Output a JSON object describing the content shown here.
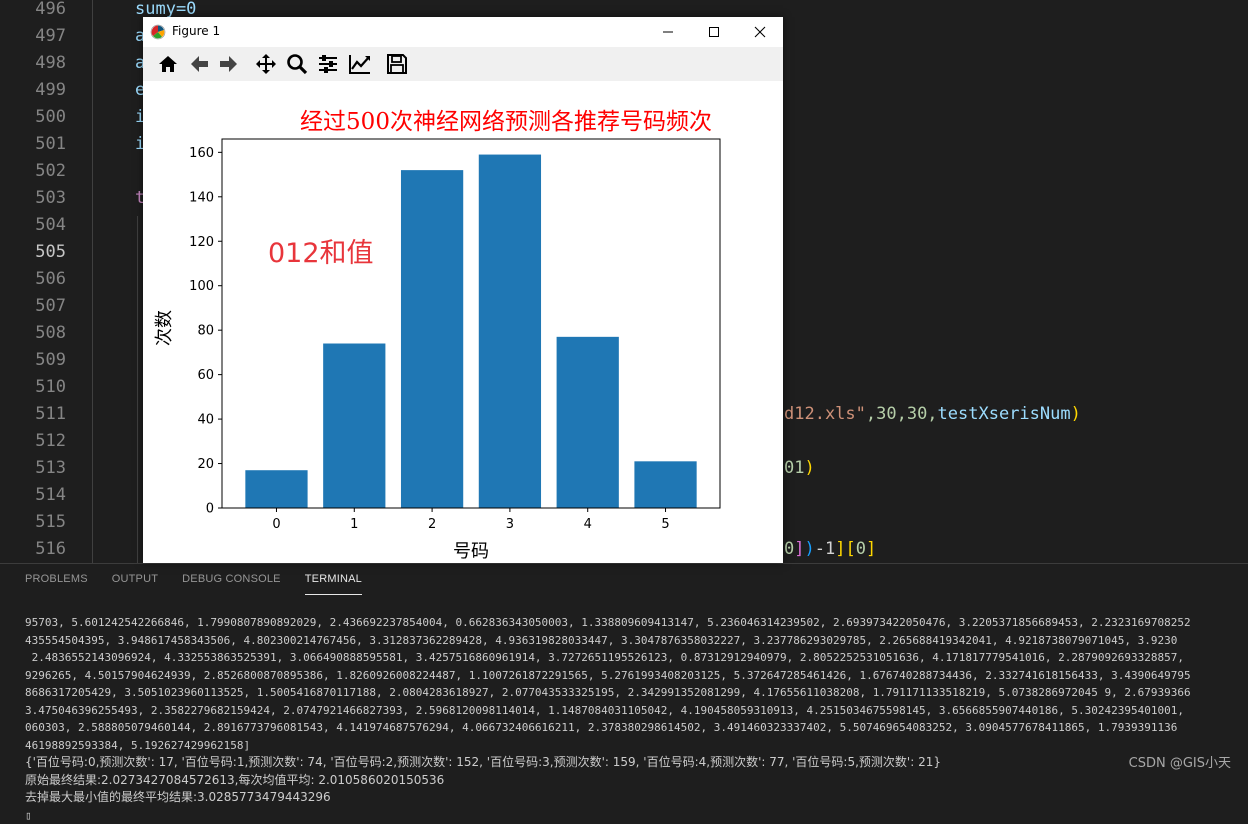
{
  "editor": {
    "line_numbers": [
      "496",
      "497",
      "498",
      "499",
      "500",
      "501",
      "502",
      "503",
      "504",
      "505",
      "506",
      "507",
      "508",
      "509",
      "510",
      "511",
      "512",
      "513",
      "514",
      "515",
      "516"
    ],
    "current_line_index": 9,
    "visible_fragments": {
      "l496": "sumy=0",
      "l497": "a",
      "l498": "a",
      "l499": "e",
      "l500": "i",
      "l501": "i",
      "l503": "t",
      "l511_str": "d12.xls\"",
      "l511_args": ",30,30,",
      "l511_var": "testXserisNum",
      "l511_paren": ")",
      "l513_num": "01",
      "l513_paren": ")",
      "l516_idx": "0",
      "l516_b1": "]",
      "l516_p": ")",
      "l516_m": "-1",
      "l516_b2": "][",
      "l516_zero": "0",
      "l516_b3": "]"
    }
  },
  "panel": {
    "tabs": [
      "PROBLEMS",
      "OUTPUT",
      "DEBUG CONSOLE",
      "TERMINAL"
    ],
    "active_tab": "TERMINAL",
    "terminal_lines": [
      "95703, 5.601242542266846, 1.7990807890892029, 2.436692237854004, 0.662836343050003, 1.338809609413147, 5.236046314239502, 2.693973422050476, 3.2205371856689453, 2.2323169708252",
      "435554504395, 3.948617458343506, 4.802300214767456, 3.312837362289428, 4.936319828033447, 3.3047876358032227, 3.237786293029785, 2.265688419342041, 4.9218738079071045, 3.9230",
      " 2.4836552143096924, 4.332553863525391, 3.066490888595581, 3.4257516860961914, 3.7272651195526123, 0.87312912940979, 2.8052252531051636, 4.171817779541016, 2.2879092693328857,",
      "9296265, 4.50157904624939, 2.8526800870895386, 1.8260926008224487, 1.1007261872291565, 5.2761993408203125, 5.372647285461426, 1.676740288734436, 2.332741618156433, 3.4390649795",
      "8686317205429, 3.5051023960113525, 1.5005416870117188, 2.0804283618927, 2.077043533325195, 2.342991352081299, 4.17655611038208, 1.791171133518219, 5.0738286972045 9, 2.67939366",
      "3.475046396255493, 2.3582279682159424, 2.0747921466827393, 2.5968120098114014, 1.1487084031105042, 4.190458059310913, 4.2515034675598145, 3.6566855907440186, 5.30242395401001,",
      "060303, 2.588805079460144, 2.8916773796081543, 4.141974687576294, 4.066732406616211, 2.378380298614502, 3.491460323337402, 5.507469654083252, 3.0904577678411865, 1.7939391136",
      "46198892593384, 5.192627429962158]",
      "{'百位号码:0,预测次数': 17, '百位号码:1,预测次数': 74, '百位号码:2,预测次数': 152, '百位号码:3,预测次数': 159, '百位号码:4,预测次数': 77, '百位号码:5,预测次数': 21}",
      "原始最终结果:2.0273427084572613,每次均值平均: 2.010586020150536",
      "去掉最大最小值的最终平均结果:3.0285773479443296",
      "▯"
    ],
    "watermark": "CSDN @GIS小天"
  },
  "figure": {
    "window_title": "Figure 1",
    "toolbar_buttons": [
      "home-icon",
      "back-icon",
      "forward-icon",
      "pan-icon",
      "zoom-icon",
      "configure-subplots-icon",
      "edit-axis-icon",
      "save-icon"
    ],
    "colors": {
      "bar": "#1f77b4",
      "title": "#ff0000",
      "annotation": "#e8353b"
    }
  },
  "chart_data": {
    "type": "bar",
    "title": "经过500次神经网络预测各推荐号码频次",
    "xlabel": "号码",
    "ylabel": "次数",
    "categories": [
      "0",
      "1",
      "2",
      "3",
      "4",
      "5"
    ],
    "values": [
      17,
      74,
      152,
      159,
      77,
      21
    ],
    "ylim": [
      0,
      166
    ],
    "yticks": [
      0,
      20,
      40,
      60,
      80,
      100,
      120,
      140,
      160
    ],
    "annotation": "012和值",
    "grid": false,
    "legend": "none"
  }
}
